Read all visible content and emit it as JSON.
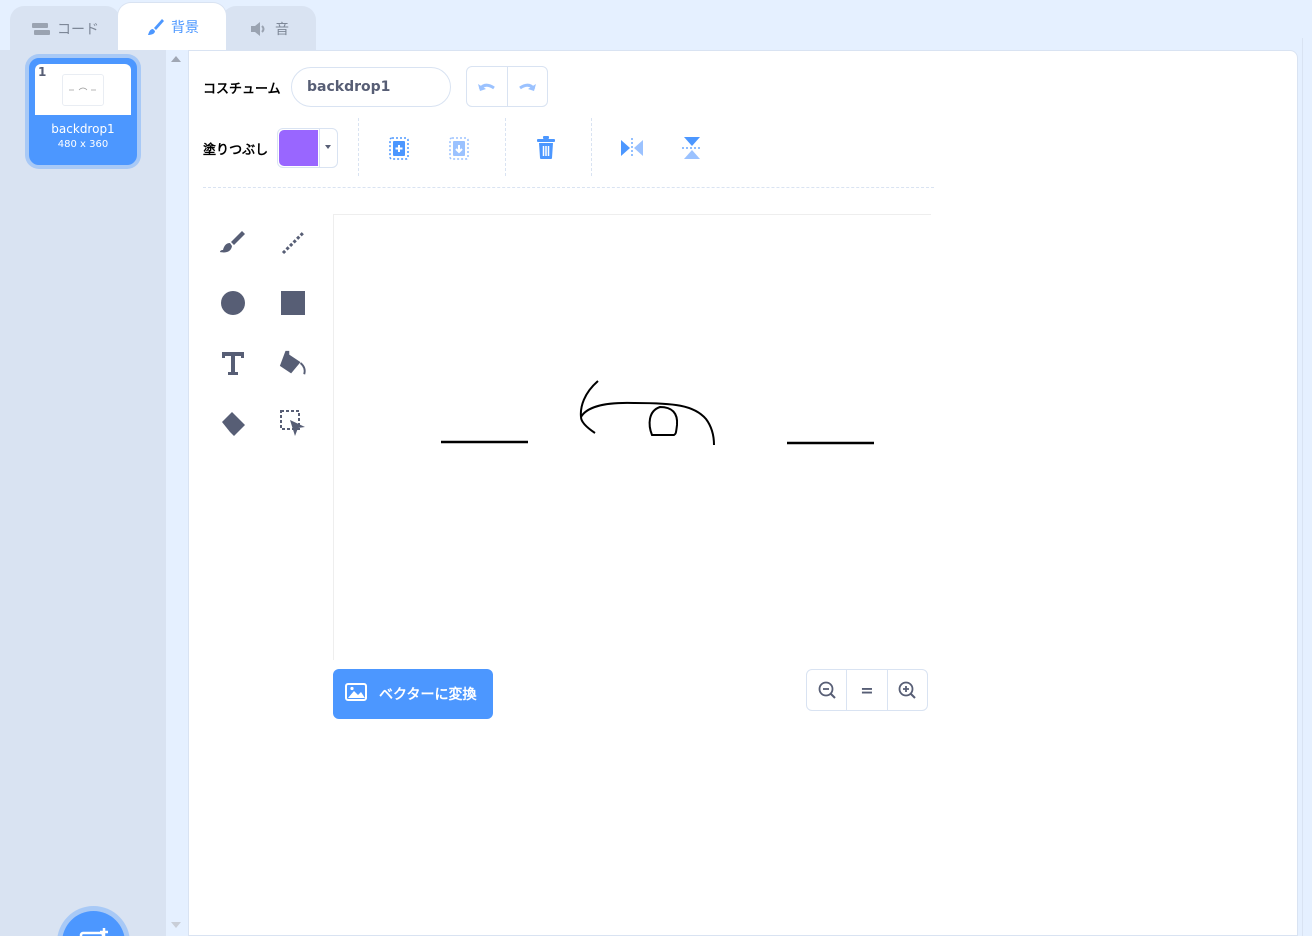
{
  "tabs": [
    {
      "label": "コード",
      "icon": "code-blocks-icon"
    },
    {
      "label": "背景",
      "icon": "paintbrush-icon"
    },
    {
      "label": "音",
      "icon": "speaker-icon"
    }
  ],
  "costumes": [
    {
      "number": "1",
      "name": "backdrop1",
      "size": "480 x 360"
    }
  ],
  "editor": {
    "costume_label": "コスチューム",
    "costume_name": "backdrop1",
    "fill_label": "塗りつぶし",
    "fill_color": "#9966ff",
    "convert_button": "ベクターに変換",
    "zoom_reset": "="
  },
  "colors": {
    "accent": "#4c97ff",
    "panel_bg": "#e5f0ff",
    "icon_gray": "#575e75"
  }
}
